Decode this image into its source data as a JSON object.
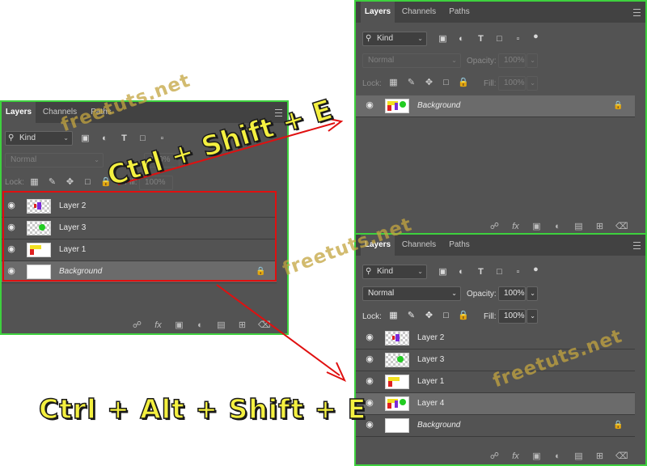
{
  "tabs": [
    "Layers",
    "Channels",
    "Paths"
  ],
  "filter": {
    "label": "Kind"
  },
  "blend_mode": "Normal",
  "opacity": {
    "label": "Opacity:",
    "value": "100%"
  },
  "fill": {
    "label": "Fill:",
    "value": "100%"
  },
  "lock_label": "Lock:",
  "panel_left": {
    "layers": [
      {
        "name": "Layer 2"
      },
      {
        "name": "Layer 3"
      },
      {
        "name": "Layer 1"
      },
      {
        "name": "Background"
      }
    ]
  },
  "panel_top_right": {
    "layers": [
      {
        "name": "Background"
      }
    ]
  },
  "panel_bottom_right": {
    "layers": [
      {
        "name": "Layer 2"
      },
      {
        "name": "Layer 3"
      },
      {
        "name": "Layer 1"
      },
      {
        "name": "Layer 4"
      },
      {
        "name": "Background"
      }
    ]
  },
  "captions": {
    "ctrl_shift_e": "Ctrl + Shift + E",
    "ctrl_alt_shift_e": "Ctrl + Alt + Shift + E"
  },
  "watermark": "freetuts.net",
  "colors": {
    "panel_border": "#3ed13e",
    "highlight_box": "#e01010",
    "arrow": "#e01010",
    "caption_fill": "#f4f040"
  }
}
